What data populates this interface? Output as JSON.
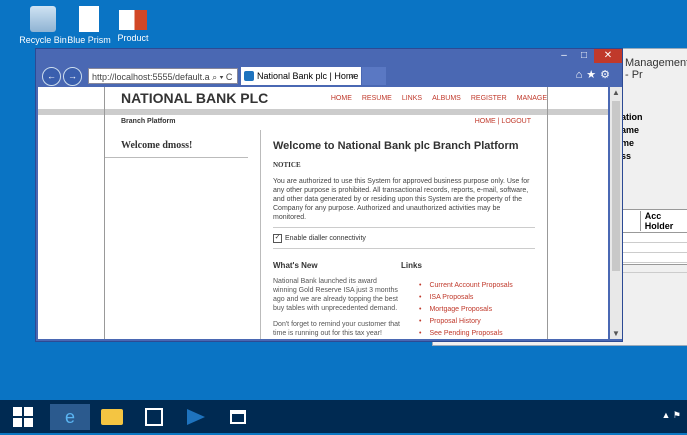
{
  "desktop": {
    "icons": [
      {
        "label": "Recycle Bin"
      },
      {
        "label": "Blue Prism"
      },
      {
        "label": "Product"
      }
    ]
  },
  "background_window": {
    "title": "Management - Pr",
    "labels": [
      "ation",
      "ame",
      "me",
      "ss"
    ],
    "table_header": "Acc Holder"
  },
  "browser": {
    "address": "http://localhost:5555/default.a",
    "address_host": "localhost",
    "search_icon": "⌕ ▾ C",
    "tab_title": "National Bank plc | Home",
    "tab_close": "×"
  },
  "site": {
    "logo": "NATIONAL BANK PLC",
    "menu": [
      "HOME",
      "RESUME",
      "LINKS",
      "ALBUMS",
      "REGISTER",
      "MANAGE"
    ],
    "subheader": "Branch Platform",
    "sublinks": "HOME  |  LOGOUT",
    "sidebar_welcome": "Welcome dmoss!",
    "main_title": "Welcome to National Bank plc Branch Platform",
    "notice_title": "NOTICE",
    "notice_text": "You are authorized to use this System for approved business purpose only. Use for any other purpose is prohibited. All transactional records, reports, e-mail, software, and other data generated by or residing upon this System are the property of the Company for any purpose. Authorized and unauthorized activities may be monitored.",
    "dialler_label": "Enable dialler connectivity",
    "whats_new_title": "What's New",
    "whats_new_p1": "National Bank launched its award winning Gold Reserve ISA just 3 months ago and we are already topping the best buy tables with unprecedented demand.",
    "whats_new_p2": "Don't forget to remind your customer that time is running out for this tax year!",
    "links_title": "Links",
    "links": [
      "Current Account Proposals",
      "ISA Proposals",
      "Mortgage Proposals",
      "Proposal History",
      "See Pending Proposals"
    ]
  },
  "icons": {
    "back": "back-arrow-icon",
    "forward": "forward-arrow-icon",
    "home": "home-icon",
    "favorites": "star-icon",
    "settings": "gear-icon"
  }
}
